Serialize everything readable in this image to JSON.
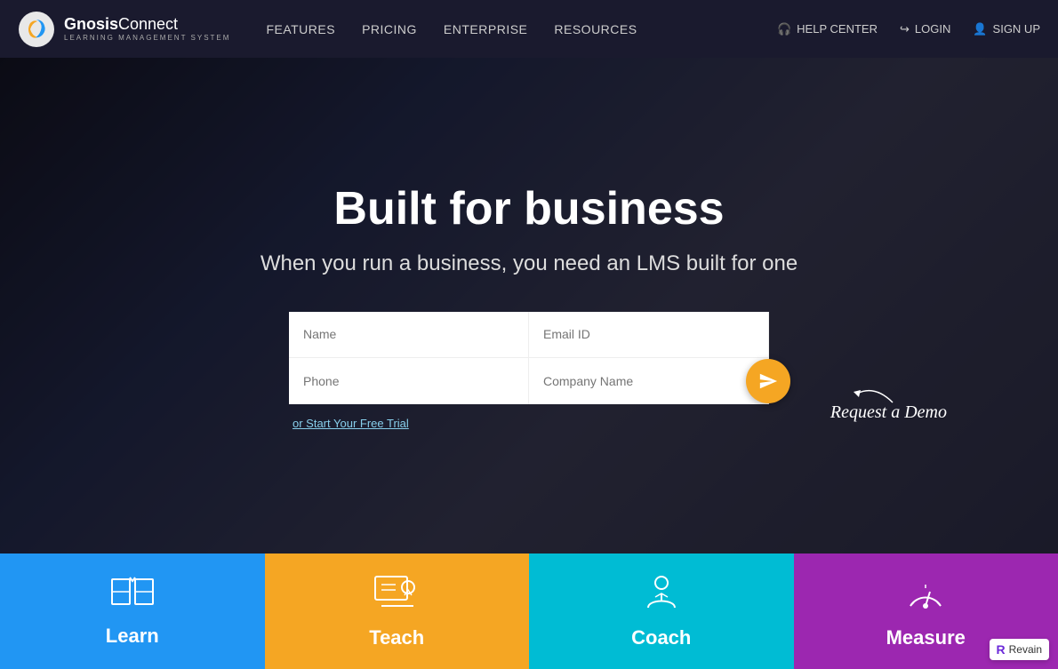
{
  "navbar": {
    "logo": {
      "text_gnosis": "Gnosis",
      "text_connect": "Connect",
      "subtitle": "LEARNING MANAGEMENT SYSTEM"
    },
    "links": [
      {
        "label": "FEATURES",
        "id": "features"
      },
      {
        "label": "PRICING",
        "id": "pricing"
      },
      {
        "label": "ENTERPRISE",
        "id": "enterprise"
      },
      {
        "label": "RESOURCES",
        "id": "resources"
      }
    ],
    "right": [
      {
        "label": "HELP CENTER",
        "id": "help-center",
        "icon": "headphone"
      },
      {
        "label": "LOGIN",
        "id": "login",
        "icon": "login-arrow"
      },
      {
        "label": "SIGN UP",
        "id": "signup",
        "icon": "user"
      }
    ]
  },
  "hero": {
    "title": "Built for business",
    "subtitle": "When you run a business, you need an LMS built for one",
    "form": {
      "name_placeholder": "Name",
      "phone_placeholder": "Phone",
      "email_placeholder": "Email ID",
      "company_placeholder": "Company Name"
    },
    "free_trial_link": "or Start Your Free Trial",
    "request_demo_text": "Request a Demo"
  },
  "tiles": [
    {
      "id": "learn",
      "label": "Learn",
      "color": "#2196f3"
    },
    {
      "id": "teach",
      "label": "Teach",
      "color": "#f5a623"
    },
    {
      "id": "coach",
      "label": "Coach",
      "color": "#00bcd4"
    },
    {
      "id": "measure",
      "label": "Measure",
      "color": "#9c27b0"
    }
  ],
  "revain": {
    "label": "Revain"
  }
}
